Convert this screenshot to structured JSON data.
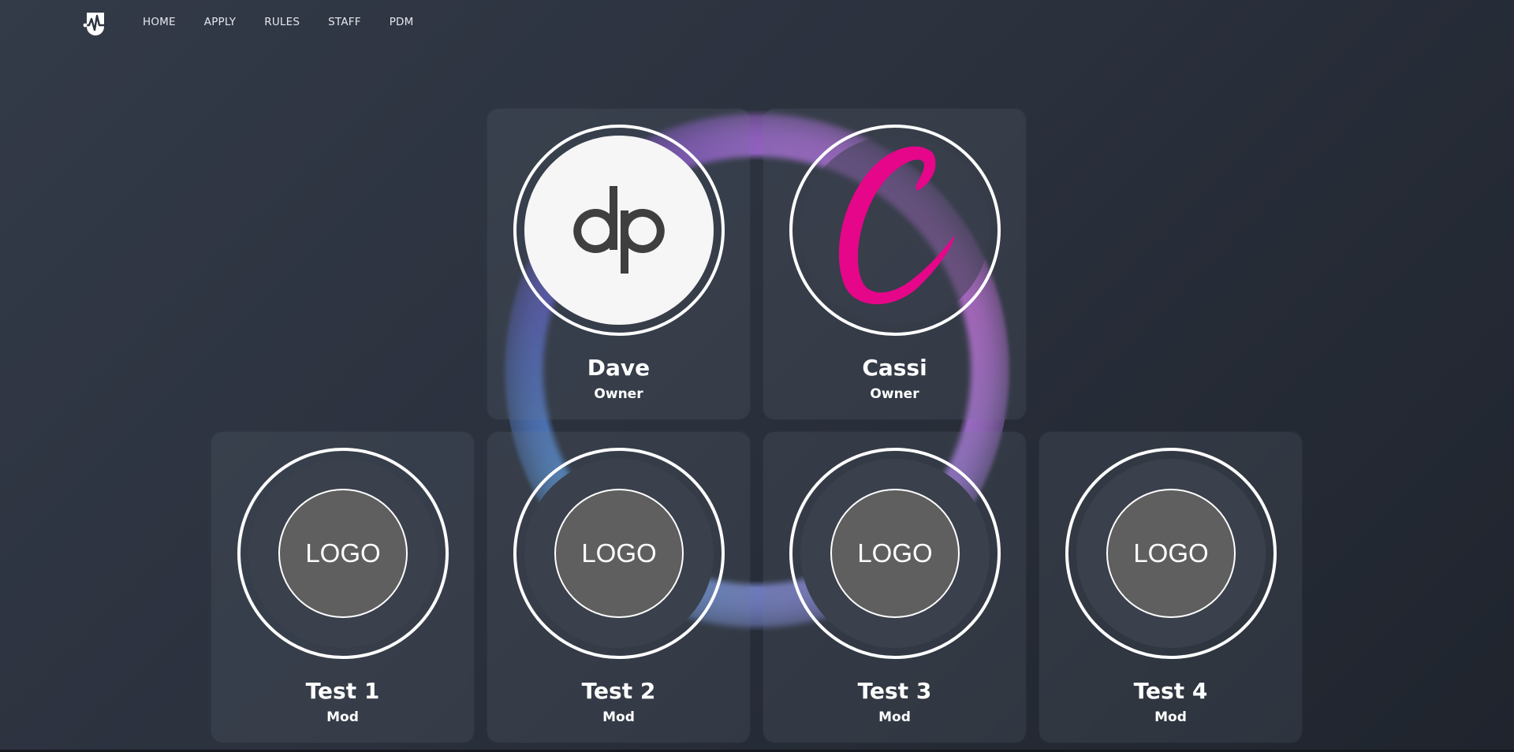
{
  "nav": {
    "logo_icon": "heartbeat-brand-icon",
    "links": [
      "HOME",
      "APPLY",
      "RULES",
      "STAFF",
      "PDM"
    ]
  },
  "staff": [
    {
      "name": "Dave",
      "role": "Owner",
      "avatar": "dp-monogram"
    },
    {
      "name": "Cassi",
      "role": "Owner",
      "avatar": "pink-c-letter"
    },
    {
      "name": "Test 1",
      "role": "Mod",
      "avatar_text": "LOGO"
    },
    {
      "name": "Test 2",
      "role": "Mod",
      "avatar_text": "LOGO"
    },
    {
      "name": "Test 3",
      "role": "Mod",
      "avatar_text": "LOGO"
    },
    {
      "name": "Test 4",
      "role": "Mod",
      "avatar_text": "LOGO"
    }
  ],
  "colors": {
    "accent_pink": "#e5068a",
    "card_ring": "#ffffff",
    "logo_placeholder": "#5f5f5f"
  }
}
